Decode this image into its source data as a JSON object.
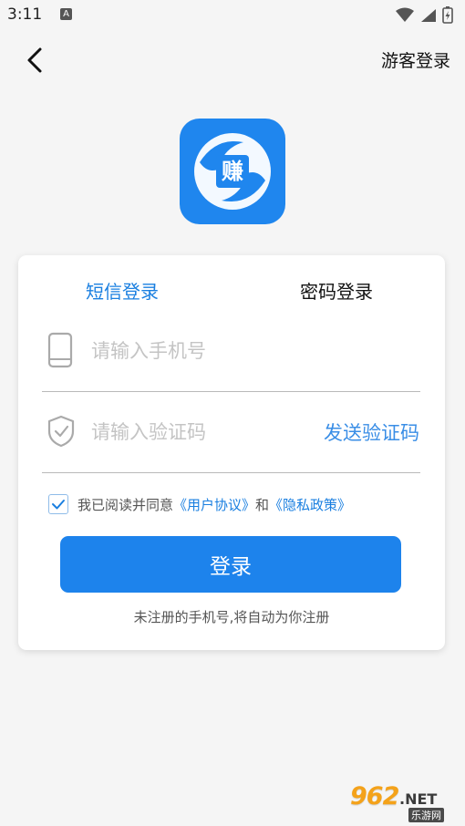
{
  "status_bar": {
    "time": "3:11",
    "notif_icon_letter": "A"
  },
  "header": {
    "guest_login": "游客登录"
  },
  "logo": {
    "char": "赚",
    "color": "#1f86ee"
  },
  "tabs": {
    "sms": "短信登录",
    "password": "密码登录"
  },
  "phone_field": {
    "placeholder": "请输入手机号",
    "icon": "phone-icon"
  },
  "code_field": {
    "placeholder": "请输入验证码",
    "icon": "shield-icon",
    "send_code": "发送验证码"
  },
  "agreement": {
    "checked": true,
    "prefix": "我已阅读并同意",
    "user_agreement": "《用户协议》",
    "and": "和",
    "privacy_policy": "《隐私政策》"
  },
  "login_button": "登录",
  "hint": "未注册的手机号,将自动为你注册",
  "watermark": {
    "brand": "962",
    "net": ".NET",
    "sub": "乐游网"
  },
  "colors": {
    "accent": "#1d83ec",
    "link": "#1a7fe0",
    "background": "#f5f5f5"
  }
}
